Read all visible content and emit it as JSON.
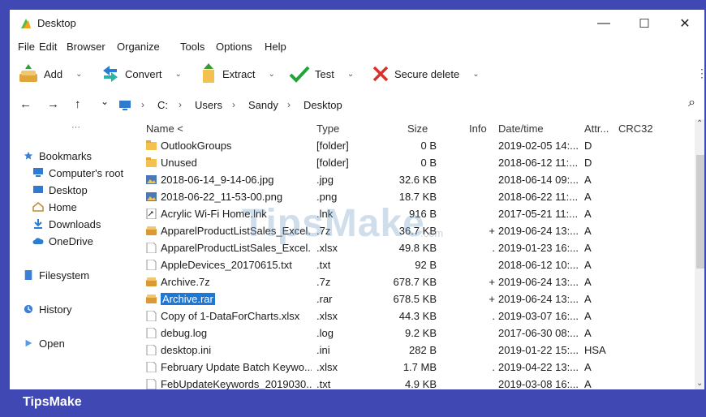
{
  "window": {
    "title": "Desktop",
    "minimize": "—",
    "maximize": "☐",
    "close": "✕"
  },
  "menu": [
    "File",
    "Edit",
    "Browser",
    "Organize",
    "Tools",
    "Options",
    "Help"
  ],
  "toolbar": {
    "add": "Add",
    "convert": "Convert",
    "extract": "Extract",
    "test": "Test",
    "secure_delete": "Secure delete",
    "more": "⋮"
  },
  "address": {
    "back": "←",
    "forward": "→",
    "up": "↑",
    "dropdown": "⌄",
    "crumbs": [
      "C:",
      "Users",
      "Sandy",
      "Desktop"
    ],
    "search": "⌕"
  },
  "sidebar": {
    "more": "···",
    "bookmarks": "Bookmarks",
    "computers_root": "Computer's root",
    "desktop": "Desktop",
    "home": "Home",
    "downloads": "Downloads",
    "onedrive": "OneDrive",
    "filesystem": "Filesystem",
    "history": "History",
    "open": "Open"
  },
  "columns": {
    "name": "Name <",
    "type": "Type",
    "size": "Size",
    "info": "Info",
    "datetime": "Date/time",
    "attr": "Attr...",
    "crc": "CRC32"
  },
  "files": [
    {
      "name": "OutlookGroups",
      "type": "[folder]",
      "size": "0 B",
      "info": "",
      "date": "2019-02-05 14:...",
      "attr": "D"
    },
    {
      "name": "Unused",
      "type": "[folder]",
      "size": "0 B",
      "info": "",
      "date": "2018-06-12 11:...",
      "attr": "D"
    },
    {
      "name": "2018-06-14_9-14-06.jpg",
      "type": ".jpg",
      "size": "32.6 KB",
      "info": "",
      "date": "2018-06-14 09:...",
      "attr": "A"
    },
    {
      "name": "2018-06-22_11-53-00.png",
      "type": ".png",
      "size": "18.7 KB",
      "info": "",
      "date": "2018-06-22 11:...",
      "attr": "A"
    },
    {
      "name": "Acrylic Wi-Fi Home.lnk",
      "type": ".lnk",
      "size": "916 B",
      "info": "",
      "date": "2017-05-21 11:...",
      "attr": "A"
    },
    {
      "name": "ApparelProductListSales_Excel...",
      "type": ".7z",
      "size": "36.7 KB",
      "info": "+",
      "date": "2019-06-24 13:...",
      "attr": "A"
    },
    {
      "name": "ApparelProductListSales_Excel...",
      "type": ".xlsx",
      "size": "49.8 KB",
      "info": ".",
      "date": "2019-01-23 16:...",
      "attr": "A"
    },
    {
      "name": "AppleDevices_20170615.txt",
      "type": ".txt",
      "size": "92 B",
      "info": "",
      "date": "2018-06-12 10:...",
      "attr": "A"
    },
    {
      "name": "Archive.7z",
      "type": ".7z",
      "size": "678.7 KB",
      "info": "+",
      "date": "2019-06-24 13:...",
      "attr": "A"
    },
    {
      "name": "Archive.rar",
      "type": ".rar",
      "size": "678.5 KB",
      "info": "+",
      "date": "2019-06-24 13:...",
      "attr": "A"
    },
    {
      "name": "Copy of 1-DataForCharts.xlsx",
      "type": ".xlsx",
      "size": "44.3 KB",
      "info": ".",
      "date": "2019-03-07 16:...",
      "attr": "A"
    },
    {
      "name": "debug.log",
      "type": ".log",
      "size": "9.2 KB",
      "info": "",
      "date": "2017-06-30 08:...",
      "attr": "A"
    },
    {
      "name": "desktop.ini",
      "type": ".ini",
      "size": "282 B",
      "info": "",
      "date": "2019-01-22 15:...",
      "attr": "HSA"
    },
    {
      "name": "February Update Batch Keywo...",
      "type": ".xlsx",
      "size": "1.7 MB",
      "info": ".",
      "date": "2019-04-22 13:...",
      "attr": "A"
    },
    {
      "name": "FebUpdateKeywords_2019030...",
      "type": ".txt",
      "size": "4.9 KB",
      "info": "",
      "date": "2019-03-08 16:...",
      "attr": "A"
    }
  ],
  "watermark": {
    "big": "TipsMake",
    "small": ".com"
  },
  "footer": {
    "brand": "TipsMake"
  },
  "colors": {
    "frame": "#3f48b3",
    "selection": "#1e78d6",
    "folder": "#f2c14e"
  }
}
